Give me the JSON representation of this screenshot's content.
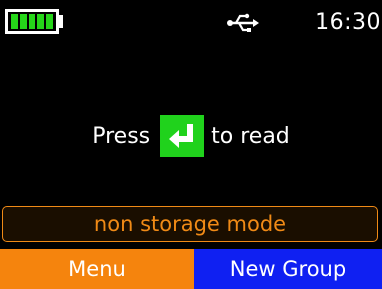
{
  "status_bar": {
    "battery_level_fraction": 1.0,
    "battery_segments": 5,
    "battery_color": "#25d619",
    "connection_icon": "usb-icon",
    "time": "16:30"
  },
  "prompt": {
    "before": "Press",
    "key_icon": "enter-key-icon",
    "key_color": "#20d21c",
    "after": "to read"
  },
  "mode": {
    "label": "non storage mode",
    "color": "#f08a16"
  },
  "softkeys": {
    "left_label": "Menu",
    "left_color": "#f5840d",
    "right_label": "New Group",
    "right_color": "#0f20f2"
  }
}
